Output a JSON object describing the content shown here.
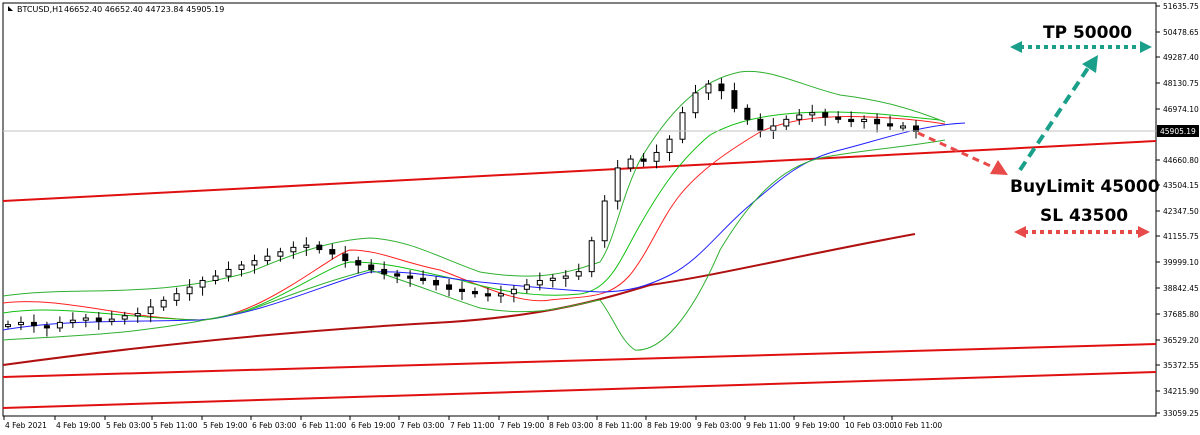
{
  "header": {
    "symbol_label": "BTCUSD,H1",
    "ohlc": "46652.40 46652.40 44723.84 45905.19"
  },
  "price_axis": {
    "labels": [
      "51635.75",
      "50478.65",
      "49287.40",
      "48130.75",
      "46974.10",
      "45905.19",
      "44660.80",
      "43504.15",
      "42347.50",
      "41155.75",
      "39999.10",
      "38842.45",
      "37685.80",
      "36529.20",
      "35372.55",
      "34215.90",
      "33059.25"
    ],
    "current_price": "45905.19",
    "current_price_color": "#000000"
  },
  "time_axis": {
    "labels": [
      "4 Feb 2021",
      "4 Feb 19:00",
      "5 Feb 03:00",
      "5 Feb 11:00",
      "5 Feb 19:00",
      "6 Feb 03:00",
      "6 Feb 11:00",
      "6 Feb 19:00",
      "7 Feb 03:00",
      "7 Feb 11:00",
      "7 Feb 19:00",
      "8 Feb 03:00",
      "8 Feb 11:00",
      "8 Feb 19:00",
      "9 Feb 03:00",
      "9 Feb 11:00",
      "9 Feb 19:00",
      "10 Feb 03:00",
      "10 Feb 11:00"
    ]
  },
  "annotations": {
    "tp_label": "TP 50000",
    "buy_label": "BuyLimit 45000",
    "sl_label": "SL 43500",
    "tp_color": "#1aa08a",
    "sl_color": "#e84a4a",
    "buy_arrow_color": "#e84a4a"
  },
  "colors": {
    "trendline": "#e01010",
    "ma_dark_red": "#b01010",
    "ma_red": "#ff2020",
    "ma_green": "#10c010",
    "ma_blue": "#2020ff",
    "bollinger": "#30b030",
    "candle": "#000000"
  },
  "chart_data": {
    "type": "candlestick",
    "symbol": "BTCUSD",
    "timeframe": "H1",
    "close_path": [
      37200,
      37300,
      37150,
      37050,
      37300,
      37400,
      37500,
      37350,
      37450,
      37600,
      37700,
      38000,
      38300,
      38600,
      38900,
      39200,
      39400,
      39700,
      39900,
      40100,
      40300,
      40500,
      40700,
      40800,
      40600,
      40400,
      40100,
      39900,
      39700,
      39500,
      39400,
      39300,
      39200,
      39000,
      38800,
      38700,
      38600,
      38500,
      38600,
      38800,
      39000,
      39200,
      39300,
      39400,
      39600,
      41000,
      42800,
      44300,
      44700,
      44600,
      45000,
      45600,
      46800,
      47700,
      48100,
      47800,
      47000,
      46500,
      46000,
      46200,
      46500,
      46700,
      46800,
      46600,
      46500,
      46400,
      46500,
      46300,
      46200,
      46200,
      45950
    ],
    "annotations": [
      "TP 50000",
      "BuyLimit 45000",
      "SL 43500"
    ],
    "ylim": [
      33059.25,
      51635.75
    ]
  }
}
